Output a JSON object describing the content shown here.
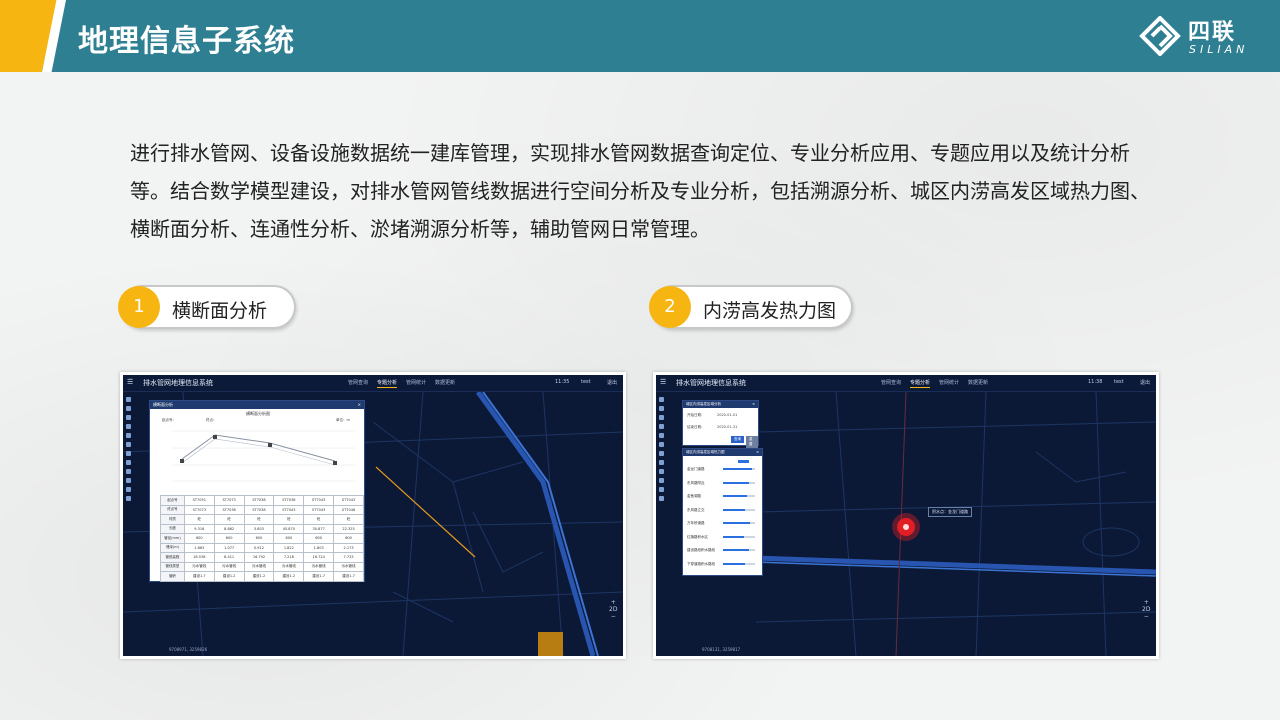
{
  "slide": {
    "title": "地理信息子系统",
    "logo": {
      "cn": "四联",
      "en": "SILIAN"
    },
    "description": "进行排水管网、设备设施数据统一建库管理，实现排水管网数据查询定位、专业分析应用、专题应用以及统计分析等。结合数学模型建设，对排水管网管线数据进行空间分析及专业分析，包括溯源分析、城区内涝高发区域热力图、横断面分析、连通性分析、淤堵溯源分析等，辅助管网日常管理。",
    "features": [
      {
        "num": "1",
        "label": "横断面分析"
      },
      {
        "num": "2",
        "label": "内涝高发热力图"
      }
    ]
  },
  "app": {
    "title": "排水管网地理信息系统",
    "menu_icon": "☰",
    "nav": [
      "管网查询",
      "专题分析",
      "管网统计",
      "数据更新"
    ],
    "active_nav": "专题分析",
    "user": "test",
    "logout": "退出",
    "time_left": "11:35",
    "time_right": "11:38",
    "zoom": {
      "plus": "+",
      "level": "2D",
      "minus": "−"
    }
  },
  "shot1": {
    "panel_title": "横断面分析",
    "close": "×",
    "chart_title": "横断面分析图",
    "meta": {
      "start": "起点号：",
      "end": "终点：",
      "unit": "单位：m"
    },
    "coords": "9708971, 3259826",
    "table": [
      [
        "起点号",
        "ST7051",
        "ST7073",
        "ST7038",
        "ST7038",
        "ST7043",
        "ST7043"
      ],
      [
        "终点号",
        "ST7073",
        "ST7038",
        "ST7038",
        "ST7043",
        "ST7043",
        "ST7046"
      ],
      [
        "材质",
        "砼",
        "砼",
        "砼",
        "砼",
        "砼",
        "砼"
      ],
      [
        "长度",
        "9.316",
        "8.862",
        "5.803",
        "45.870",
        "30.877",
        "22.325"
      ],
      [
        "管径(mm)",
        "600",
        "600",
        "600",
        "600",
        "600",
        "600"
      ],
      [
        "埋深(m)",
        "1.863",
        "1.077",
        "0.912",
        "1.822",
        "1.803",
        "2.173"
      ],
      [
        "管底高程",
        "18.538",
        "8.411",
        "16.792",
        "7.218",
        "16.724",
        "7.725"
      ],
      [
        "管线类型",
        "污水管线",
        "污水管线",
        "污水管线",
        "污水管线",
        "污水管线",
        "污水管线"
      ],
      [
        "管龄",
        "建设1.7",
        "建设1.2",
        "建设1.2",
        "建设1.2",
        "建设1.7",
        "建设1.7"
      ]
    ]
  },
  "shot2": {
    "query_title": "城区内涝高发区域分析",
    "start_label": "开始日期：",
    "start_date": "2020-01-01",
    "end_label": "结束日期：",
    "end_date": "2020-01-31",
    "query_btn": "查询",
    "reset_btn": "重置",
    "layer_title": "城区内涝高发区域热力图",
    "close": "×",
    "layers": [
      {
        "name": "金龙门道路",
        "level": 0.9
      },
      {
        "name": "东风路附近",
        "level": 0.8
      },
      {
        "name": "金鱼湖路",
        "level": 0.75
      },
      {
        "name": "东风路立交",
        "level": 0.7
      },
      {
        "name": "万年桥道路",
        "level": 0.85
      },
      {
        "name": "红旗路积水区",
        "level": 0.65
      },
      {
        "name": "建设路段积水路段",
        "level": 0.8
      },
      {
        "name": "下穿道路积水路段",
        "level": 0.7
      }
    ],
    "hotspot_label": "积水点：金龙门道路",
    "coords": "9708131, 3259817"
  }
}
